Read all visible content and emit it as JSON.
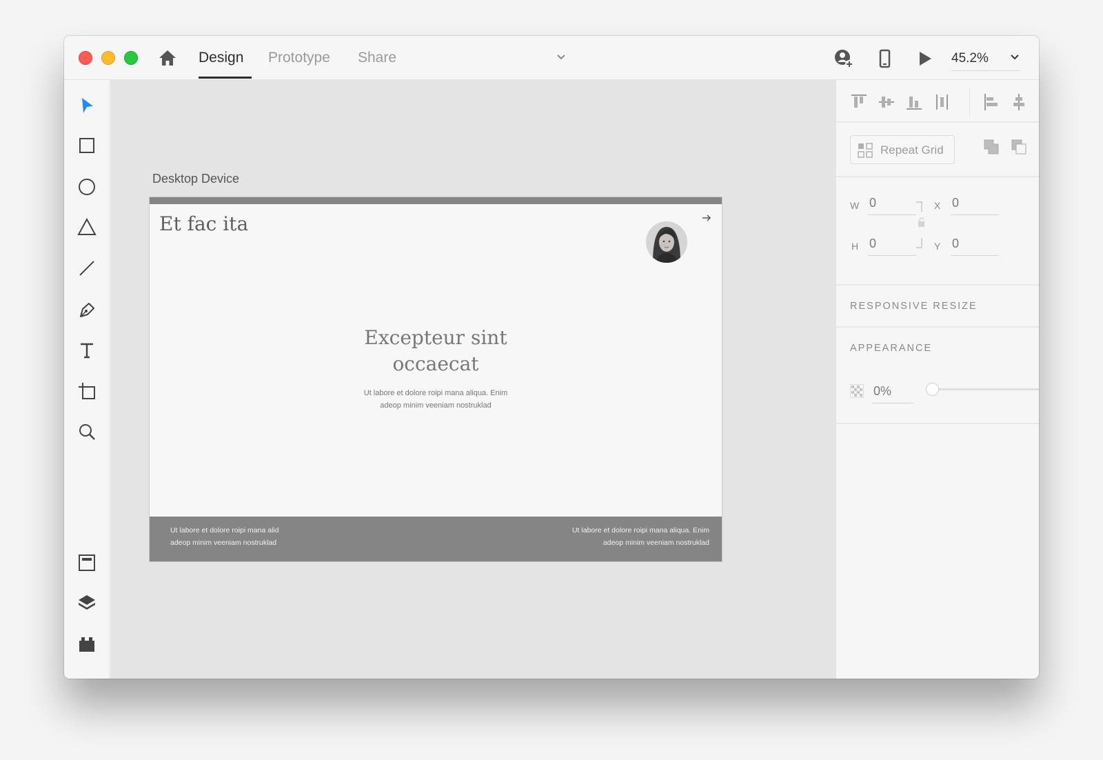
{
  "titlebar": {
    "tabs": [
      {
        "label": "Design",
        "active": true
      },
      {
        "label": "Prototype",
        "active": false
      },
      {
        "label": "Share",
        "active": false
      }
    ],
    "zoom": "45.2%"
  },
  "toolbar": {
    "tools": [
      "select-tool",
      "rectangle-tool",
      "ellipse-tool",
      "polygon-tool",
      "line-tool",
      "pen-tool",
      "text-tool",
      "artboard-tool",
      "zoom-tool"
    ],
    "bottom": [
      "assets-panel",
      "layers-panel",
      "plugins-panel"
    ]
  },
  "canvas": {
    "artboard_label": "Desktop Device",
    "artboard": {
      "brand": "Et fac ita",
      "headline_line1": "Excepteur sint",
      "headline_line2": "occaecat",
      "body_line1": "Ut labore et dolore roipi mana aliqua. Enim",
      "body_line2": "adeop minim veeniam nostruklad",
      "footer_left_line1": "Ut labore et dolore roipi mana alid",
      "footer_left_line2": "adeop minim veeniam nostruklad",
      "footer_right_line1": "Ut labore et dolore roipi mana aliqua. Enim",
      "footer_right_line2": "adeop minim veeniam nostruklad"
    }
  },
  "inspector": {
    "repeat_grid_label": "Repeat Grid",
    "w_label": "W",
    "w_value": "0",
    "h_label": "H",
    "h_value": "0",
    "x_label": "X",
    "x_value": "0",
    "y_label": "Y",
    "y_value": "0",
    "responsive_resize_label": "RESPONSIVE RESIZE",
    "responsive_resize_on": true,
    "appearance_label": "APPEARANCE",
    "opacity_value": "0%"
  },
  "colors": {
    "accent": "#1b8ef2",
    "toggle_on": "#b4b4b4",
    "artboard_bar": "#858585"
  }
}
